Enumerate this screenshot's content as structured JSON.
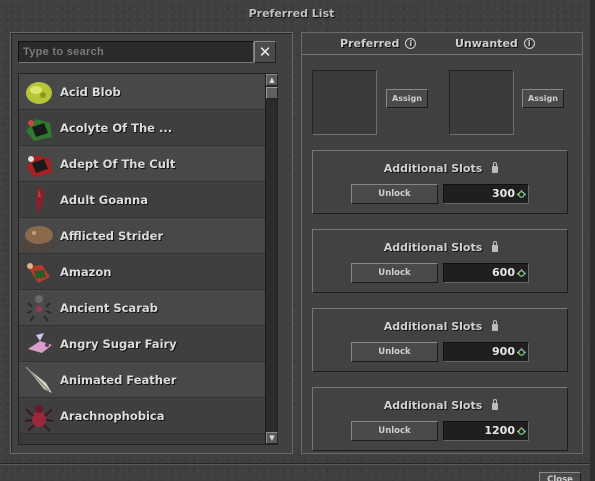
{
  "window": {
    "title": "Preferred List",
    "close_label": "Close"
  },
  "search": {
    "placeholder": "Type to search",
    "value": "",
    "clear_label": "✕"
  },
  "creatures": [
    {
      "name": "Acid Blob",
      "icon": "acid-blob-icon",
      "color": "#b6c43a"
    },
    {
      "name": "Acolyte Of The ...",
      "icon": "acolyte-icon",
      "color": "#2f7a2f"
    },
    {
      "name": "Adept Of The Cult",
      "icon": "adept-icon",
      "color": "#a62121"
    },
    {
      "name": "Adult Goanna",
      "icon": "goanna-icon",
      "color": "#8b1f2a"
    },
    {
      "name": "Afflicted Strider",
      "icon": "strider-icon",
      "color": "#8a6a4a"
    },
    {
      "name": "Amazon",
      "icon": "amazon-icon",
      "color": "#b83a2a"
    },
    {
      "name": "Ancient Scarab",
      "icon": "scarab-icon",
      "color": "#6a6a6a"
    },
    {
      "name": "Angry Sugar Fairy",
      "icon": "fairy-icon",
      "color": "#d8a0c8"
    },
    {
      "name": "Animated Feather",
      "icon": "feather-icon",
      "color": "#d8d8c8"
    },
    {
      "name": "Arachnophobica",
      "icon": "spider-icon",
      "color": "#9a2a3a"
    }
  ],
  "right_panel": {
    "tabs": [
      {
        "label": "Preferred",
        "icon": "info-icon"
      },
      {
        "label": "Unwanted",
        "icon": "info-icon"
      }
    ],
    "assign_label": "Assign",
    "slot_groups": [
      {
        "title": "Additional Slots",
        "unlock_label": "Unlock",
        "price": "300"
      },
      {
        "title": "Additional Slots",
        "unlock_label": "Unlock",
        "price": "600"
      },
      {
        "title": "Additional Slots",
        "unlock_label": "Unlock",
        "price": "900"
      },
      {
        "title": "Additional Slots",
        "unlock_label": "Unlock",
        "price": "1200"
      }
    ]
  }
}
